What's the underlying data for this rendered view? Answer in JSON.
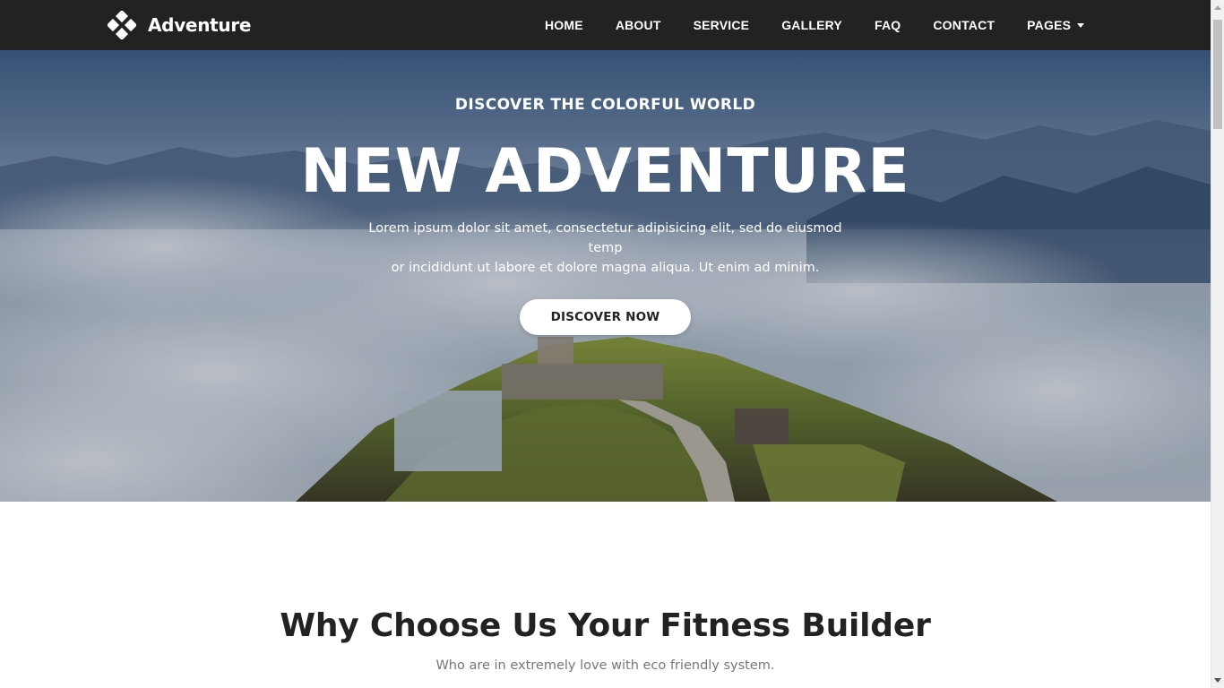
{
  "brand": {
    "name": "Adventure",
    "icon": "diamond-cluster-icon"
  },
  "nav": {
    "items": [
      {
        "label": "HOME"
      },
      {
        "label": "ABOUT"
      },
      {
        "label": "SERVICE"
      },
      {
        "label": "GALLERY"
      },
      {
        "label": "FAQ"
      },
      {
        "label": "CONTACT"
      },
      {
        "label": "PAGES",
        "dropdown": true
      }
    ]
  },
  "hero": {
    "kicker": "DISCOVER THE COLORFUL WORLD",
    "title": "NEW ADVENTURE",
    "text_line1": "Lorem ipsum dolor sit amet, consectetur adipisicing elit, sed do eiusmod temp",
    "text_line2": "or incididunt ut labore et dolore magna aliqua. Ut enim ad minim.",
    "button_label": "DISCOVER NOW"
  },
  "section": {
    "title": "Why Choose Us Your Fitness Builder",
    "subtitle": "Who are in extremely love with eco friendly system."
  },
  "colors": {
    "navbar": "#222222",
    "text_dark": "#222222",
    "text_muted": "#777777",
    "white": "#ffffff"
  }
}
